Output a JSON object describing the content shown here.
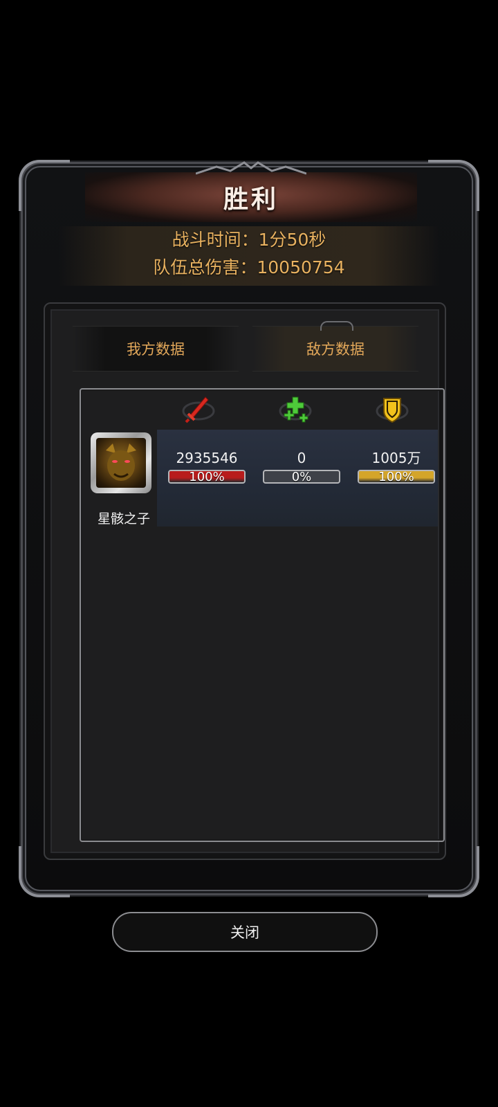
{
  "title": "胜利",
  "summary": {
    "battle_time": "战斗时间：1分50秒",
    "total_damage": "队伍总伤害：10050754"
  },
  "tabs": [
    {
      "label": "我方数据",
      "active": false
    },
    {
      "label": "敌方数据",
      "active": true
    }
  ],
  "stat_icons": [
    "sword-icon",
    "heal-cross-icon",
    "shield-icon"
  ],
  "units": [
    {
      "name": "星骸之子",
      "avatar_icon": "dragon-portrait-icon",
      "damage": {
        "value": "2935546",
        "percent_label": "100%",
        "percent": 100,
        "color": "#b81c1c"
      },
      "heal": {
        "value": "0",
        "percent_label": "0%",
        "percent": 0,
        "color": "#4a4d55"
      },
      "tank": {
        "value": "1005万",
        "percent_label": "100%",
        "percent": 100,
        "color": "#d4a52a"
      }
    }
  ],
  "close_label": "关闭"
}
